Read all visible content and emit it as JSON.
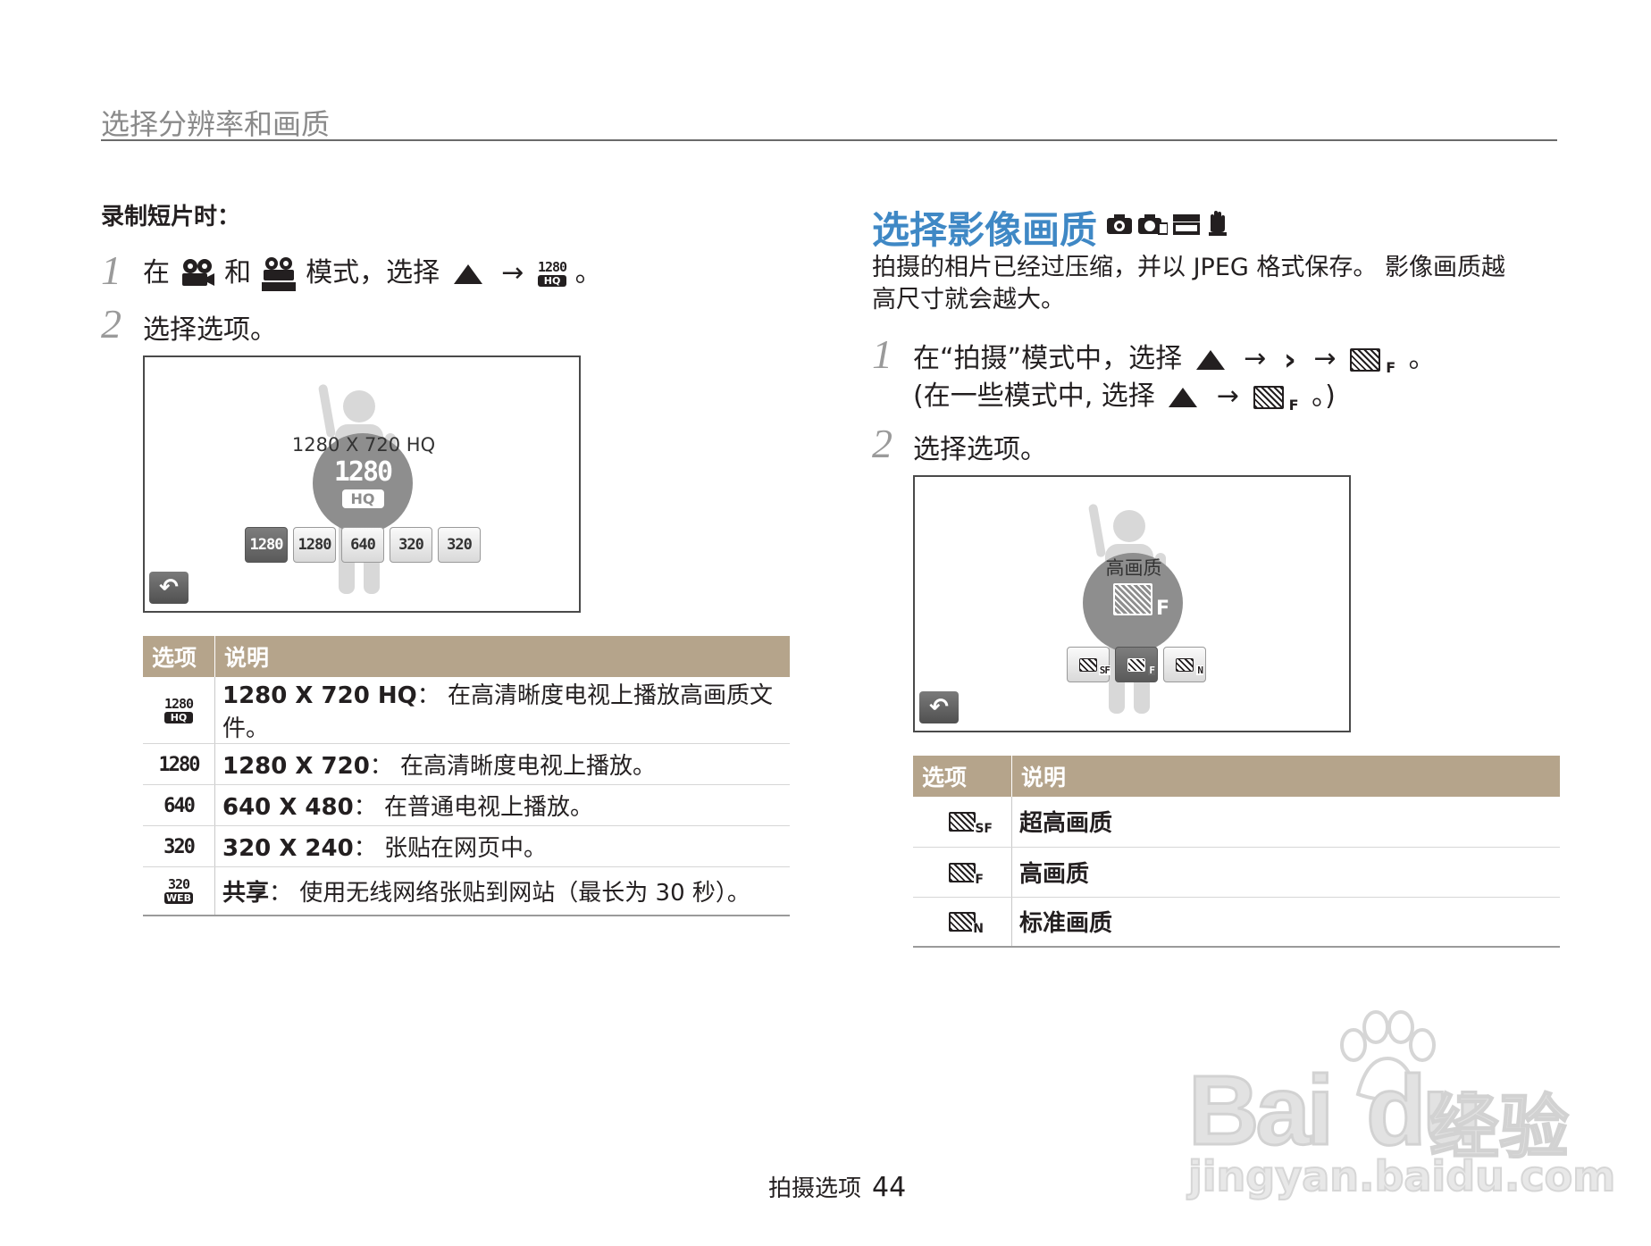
{
  "header": {
    "title": "选择分辨率和画质"
  },
  "left": {
    "subtitle": "录制短片时：",
    "step1": {
      "num": "1",
      "t1": "在",
      "t2": "和",
      "t3": "模式，选择",
      "t4": "→",
      "t5": "。"
    },
    "step2": {
      "num": "2",
      "text": "选择选项。"
    },
    "screen": {
      "bubble_label": "1280 X 720 HQ",
      "bubble_top": "1280",
      "bubble_bottom": "HQ",
      "options": [
        "1280",
        "1280",
        "640",
        "320",
        "320"
      ],
      "back_symbol": "↶"
    },
    "table": {
      "headers": [
        "选项",
        "说明"
      ],
      "rows": [
        {
          "name": "1280 X 720 HQ",
          "desc": "： 在高清晰度电视上播放高画质文件。"
        },
        {
          "name": "1280 X 720",
          "desc": "： 在高清晰度电视上播放。"
        },
        {
          "name": "640 X 480",
          "desc": "： 在普通电视上播放。"
        },
        {
          "name": "320 X 240",
          "desc": "： 张贴在网页中。"
        },
        {
          "name": "共享",
          "desc": "： 使用无线网络张贴到网站（最长为 30 秒）。"
        }
      ],
      "icons": [
        {
          "top": "1280",
          "bottom": "HQ"
        },
        {
          "top": "1280"
        },
        {
          "top": "640"
        },
        {
          "top": "320"
        },
        {
          "top": "320",
          "bottom": "WEB"
        }
      ]
    }
  },
  "right": {
    "title": "选择影像画质",
    "intro_line1": "拍摄的相片已经过压缩，并以 JPEG 格式保存。 影像画质越",
    "intro_line2": "高尺寸就会越大。",
    "step1": {
      "num": "1",
      "line1_a": "在“拍摄”模式中，选择",
      "arrow": "→",
      "chev": "›",
      "end": "。",
      "line2_a": "(在一些模式中, 选择",
      "line2_end": "。)"
    },
    "step2": {
      "num": "2",
      "text": "选择选项。"
    },
    "screen": {
      "bubble_label": "高画质",
      "bubble_suffix": "F",
      "option_suffixes": [
        "SF",
        "F",
        "N"
      ],
      "back_symbol": "↶"
    },
    "table": {
      "headers": [
        "选项",
        "说明"
      ],
      "rows": [
        {
          "suffix": "SF",
          "desc": "超高画质"
        },
        {
          "suffix": "F",
          "desc": "高画质"
        },
        {
          "suffix": "N",
          "desc": "标准画质"
        }
      ]
    }
  },
  "footer": {
    "label": "拍摄选项",
    "page": "44"
  },
  "watermark": {
    "logo": "Bai",
    "logo2": "du",
    "cn": "经验",
    "url": "jingyan.baidu.com"
  }
}
